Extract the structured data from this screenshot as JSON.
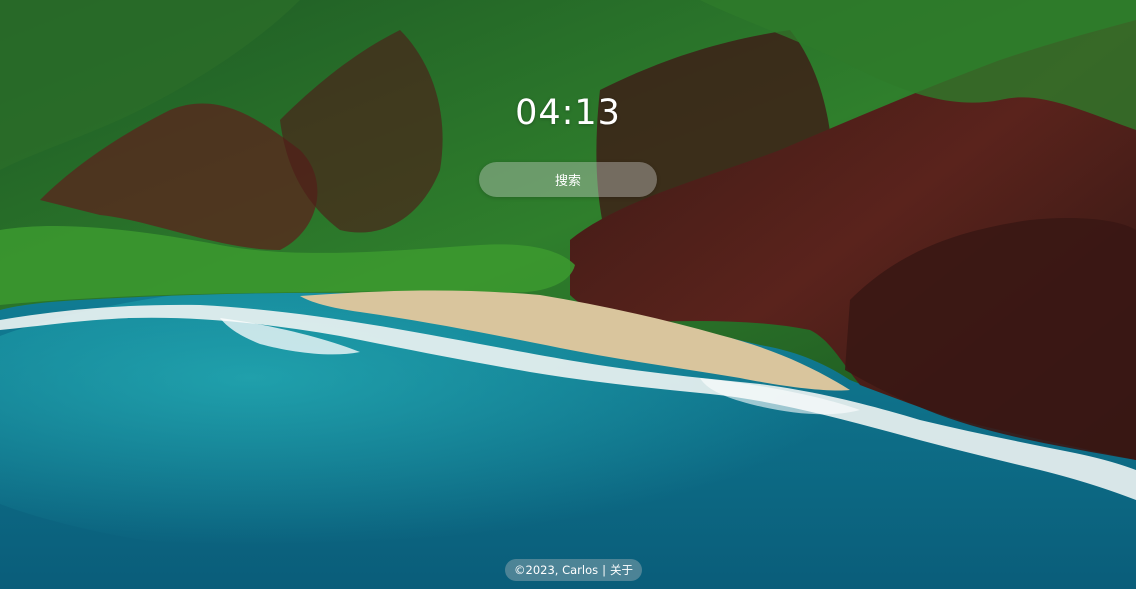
{
  "clock": {
    "time": "04:13"
  },
  "search": {
    "placeholder": "搜索"
  },
  "footer": {
    "copyright": "©2023, Carlos",
    "separator": "|",
    "about_link": "关于"
  },
  "wallpaper": {
    "scene": "coastal-mountains",
    "colors": {
      "ocean": "#0d6f86",
      "ocean_light": "#1c9bab",
      "sand": "#d8c49c",
      "surf": "#f2f6f5",
      "forest": "#2f7a2a",
      "cliff": "#4a1f1a"
    }
  }
}
